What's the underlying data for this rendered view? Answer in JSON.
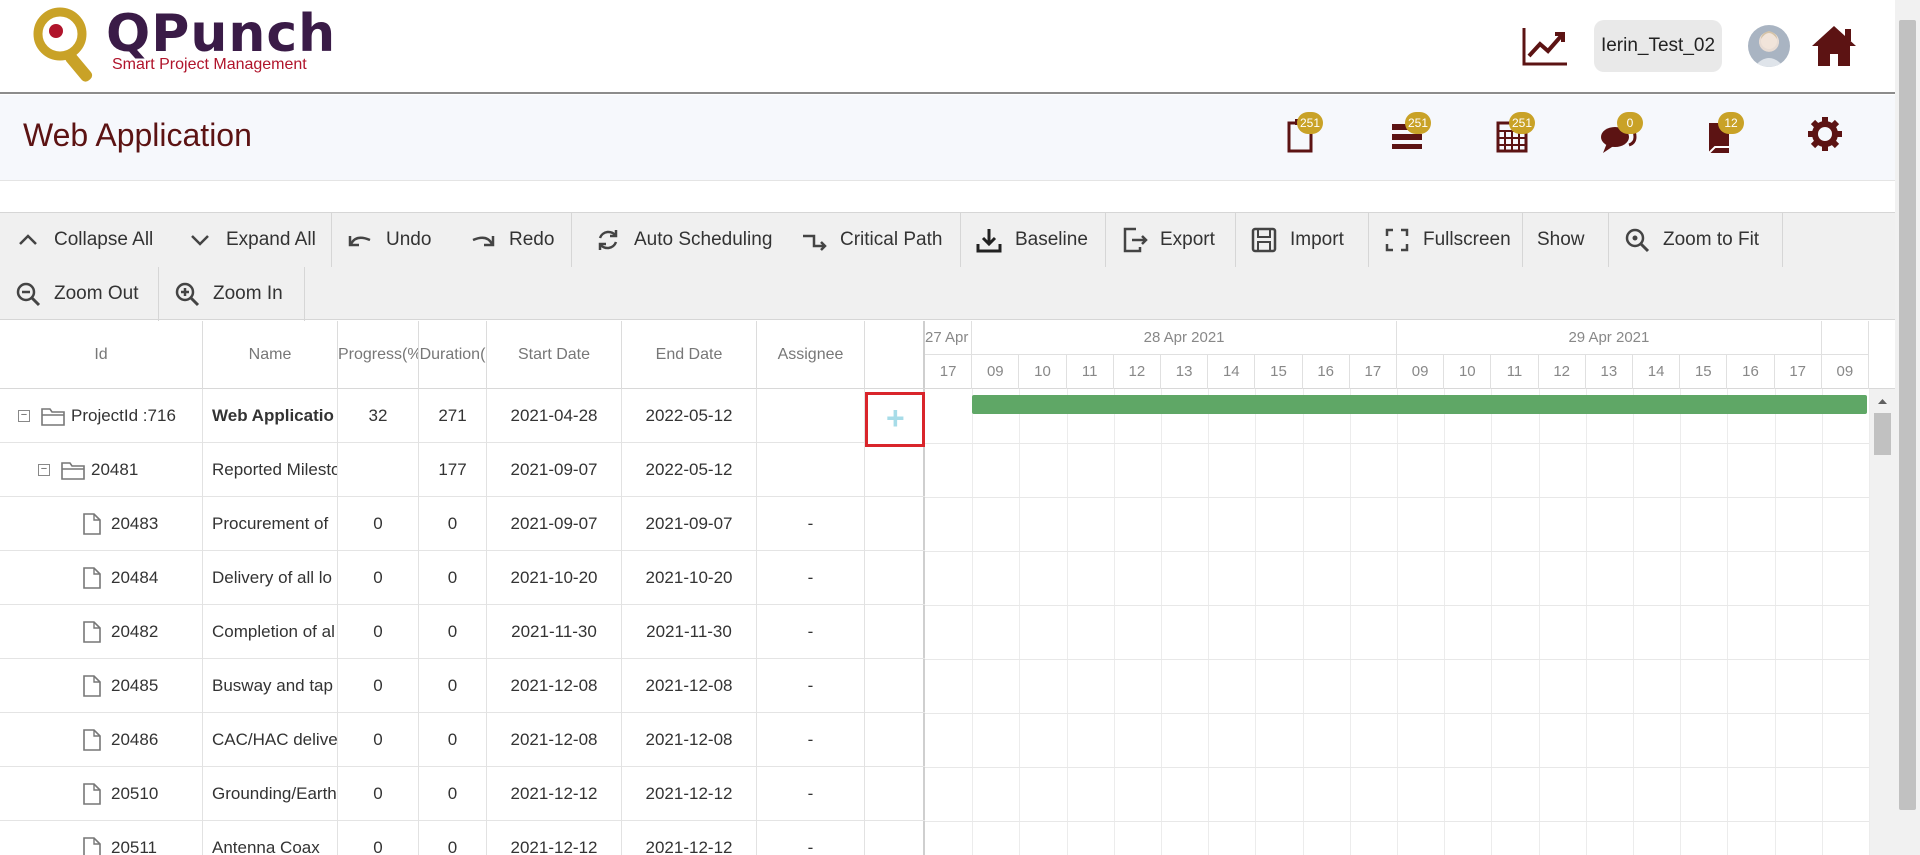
{
  "brand": {
    "name": "QPunch",
    "tagline": "Smart Project Management"
  },
  "header": {
    "username": "Ierin_Test_02"
  },
  "page": {
    "title": "Web Application"
  },
  "titlebar_icons": [
    {
      "icon": "clipboard-icon",
      "count": "251"
    },
    {
      "icon": "list-icon",
      "count": "251"
    },
    {
      "icon": "calendar-icon",
      "count": "251"
    },
    {
      "icon": "chat-icon",
      "count": "0"
    },
    {
      "icon": "book-icon",
      "count": "12"
    },
    {
      "icon": "gear-icon"
    }
  ],
  "toolbar": {
    "collapse_all": "Collapse All",
    "expand_all": "Expand All",
    "undo": "Undo",
    "redo": "Redo",
    "auto_scheduling": "Auto Scheduling",
    "critical_path": "Critical Path",
    "baseline": "Baseline",
    "export": "Export",
    "import": "Import",
    "fullscreen": "Fullscreen",
    "show": "Show",
    "zoom_to_fit": "Zoom to Fit",
    "zoom_out": "Zoom Out",
    "zoom_in": "Zoom In"
  },
  "grid": {
    "columns": [
      "Id",
      "Name",
      "Progress(%",
      "Duration(",
      "Start Date",
      "End Date",
      "Assignee"
    ],
    "rows": [
      {
        "id": "ProjectId :716",
        "name": "Web Applicatio",
        "progress": "32",
        "duration": "271",
        "start": "2021-04-28",
        "end": "2022-05-12",
        "assignee": ""
      },
      {
        "id": "20481",
        "name": "Reported Milesto",
        "progress": "",
        "duration": "177",
        "start": "2021-09-07",
        "end": "2022-05-12",
        "assignee": ""
      },
      {
        "id": "20483",
        "name": "Procurement of",
        "progress": "0",
        "duration": "0",
        "start": "2021-09-07",
        "end": "2021-09-07",
        "assignee": "-"
      },
      {
        "id": "20484",
        "name": "Delivery of all lo",
        "progress": "0",
        "duration": "0",
        "start": "2021-10-20",
        "end": "2021-10-20",
        "assignee": "-"
      },
      {
        "id": "20482",
        "name": "Completion of al",
        "progress": "0",
        "duration": "0",
        "start": "2021-11-30",
        "end": "2021-11-30",
        "assignee": "-"
      },
      {
        "id": "20485",
        "name": "Busway and tap",
        "progress": "0",
        "duration": "0",
        "start": "2021-12-08",
        "end": "2021-12-08",
        "assignee": "-"
      },
      {
        "id": "20486",
        "name": "CAC/HAC delive",
        "progress": "0",
        "duration": "0",
        "start": "2021-12-08",
        "end": "2021-12-08",
        "assignee": "-"
      },
      {
        "id": "20510",
        "name": "Grounding/Earth",
        "progress": "0",
        "duration": "0",
        "start": "2021-12-12",
        "end": "2021-12-12",
        "assignee": "-"
      },
      {
        "id": "20511",
        "name": "Antenna Coax",
        "progress": "0",
        "duration": "0",
        "start": "2021-12-12",
        "end": "2021-12-12",
        "assignee": "-"
      }
    ]
  },
  "timeline": {
    "days": [
      "27 Apr",
      "28 Apr 2021",
      "29 Apr 2021"
    ],
    "hours": [
      "17",
      "09",
      "10",
      "11",
      "12",
      "13",
      "14",
      "15",
      "16",
      "17",
      "09",
      "10",
      "11",
      "12",
      "13",
      "14",
      "15",
      "16",
      "17",
      "09"
    ]
  },
  "colors": {
    "brand_dark": "#5c1313",
    "badge": "#c9a227",
    "task_bar": "#5fa766",
    "highlight": "#d9252b"
  }
}
